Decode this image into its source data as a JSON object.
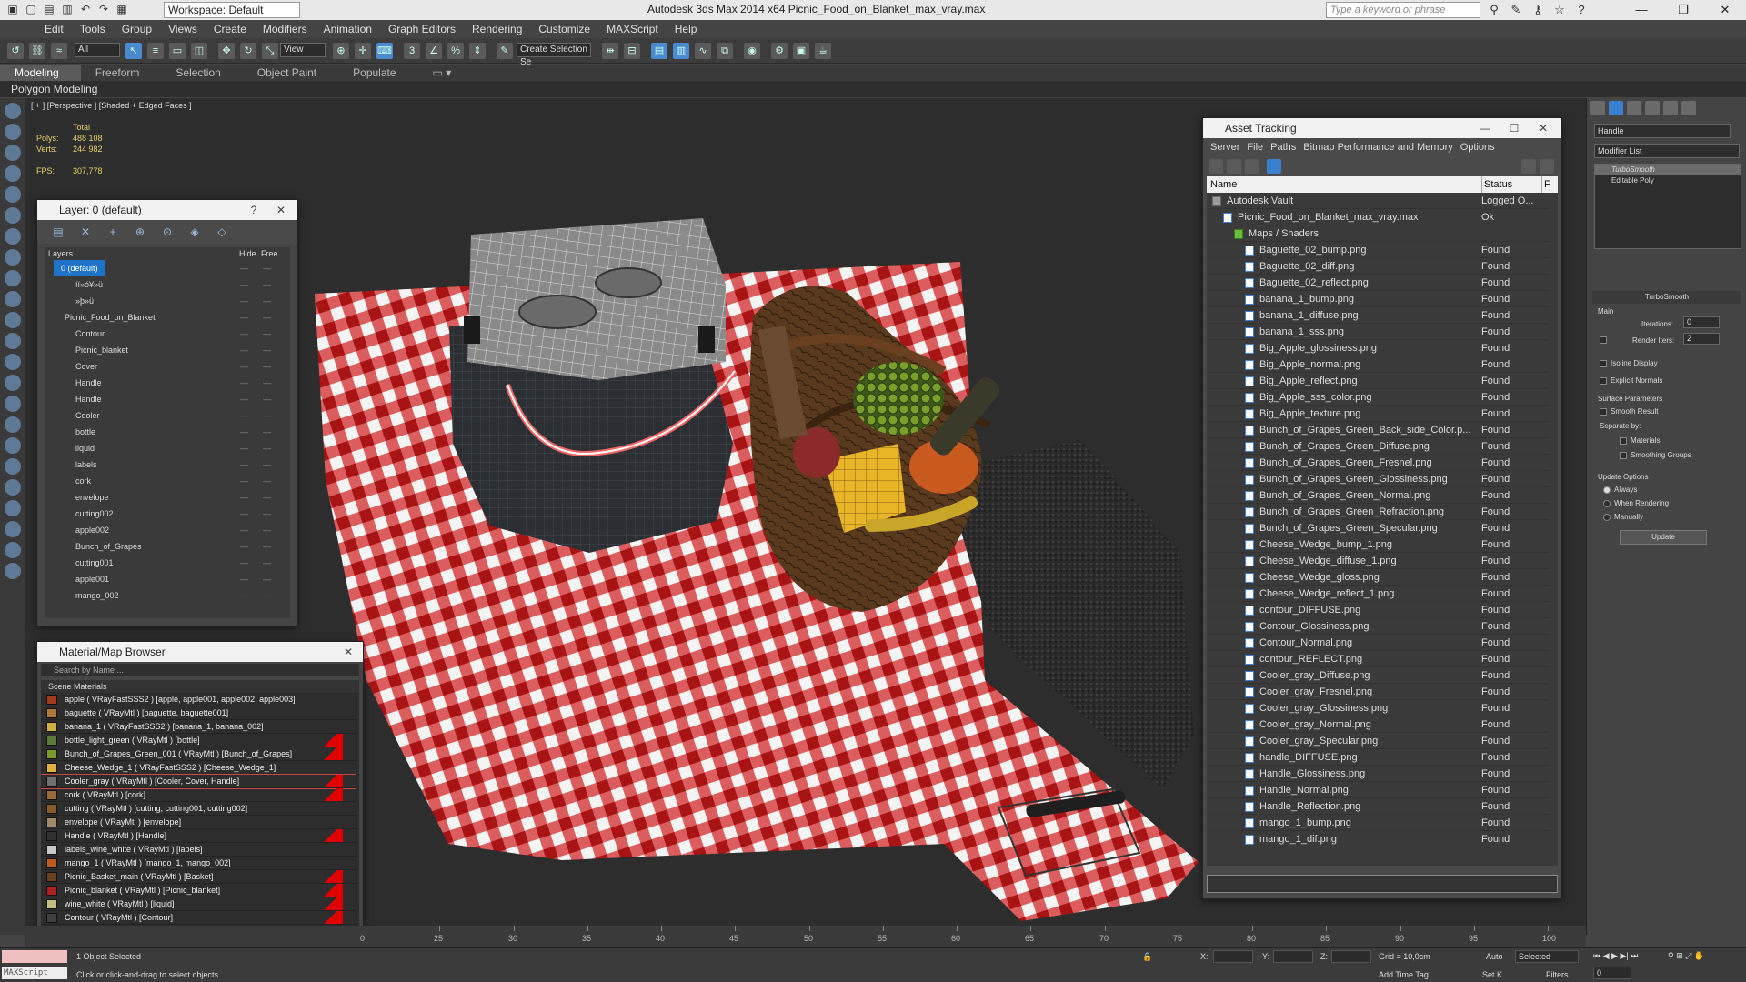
{
  "titlebar": {
    "workspace": "Workspace: Default",
    "app_title": "Autodesk 3ds Max  2014 x64     Picnic_Food_on_Blanket_max_vray.max",
    "search_placeholder": "Type a keyword or phrase"
  },
  "menu": [
    "Edit",
    "Tools",
    "Group",
    "Views",
    "Create",
    "Modifiers",
    "Animation",
    "Graph Editors",
    "Rendering",
    "Customize",
    "MAXScript",
    "Help"
  ],
  "toolbar": {
    "filter": "All",
    "ref_coord": "View",
    "selection_set": "Create Selection Se"
  },
  "ribbon": {
    "tabs": [
      "Modeling",
      "Freeform",
      "Selection",
      "Object Paint",
      "Populate"
    ],
    "active": "Modeling",
    "sub_label": "Polygon Modeling"
  },
  "viewport": {
    "label": "[ + ] [Perspective ] [Shaded + Edged Faces ]",
    "stats": {
      "header": "Total",
      "polys_label": "Polys:",
      "polys": "488 108",
      "verts_label": "Verts:",
      "verts": "244 982",
      "fps_label": "FPS:",
      "fps": "307,778"
    }
  },
  "layer_panel": {
    "title": "Layer: 0 (default)",
    "col_layers": "Layers",
    "col_hide": "Hide",
    "col_freeze": "Free",
    "rows": [
      {
        "name": "0 (default)",
        "indent": 0,
        "selected": true
      },
      {
        "name": "íí»ó¥»ü",
        "indent": 2
      },
      {
        "name": "»þ»ü",
        "indent": 2
      },
      {
        "name": "Picnic_Food_on_Blanket",
        "indent": 1
      },
      {
        "name": "Contour",
        "indent": 2
      },
      {
        "name": "Picnic_blanket",
        "indent": 2
      },
      {
        "name": "Cover",
        "indent": 2
      },
      {
        "name": "Handle",
        "indent": 2
      },
      {
        "name": "Handle",
        "indent": 2
      },
      {
        "name": "Cooler",
        "indent": 2
      },
      {
        "name": "bottle",
        "indent": 2
      },
      {
        "name": "liquid",
        "indent": 2
      },
      {
        "name": "labels",
        "indent": 2
      },
      {
        "name": "cork",
        "indent": 2
      },
      {
        "name": "envelope",
        "indent": 2
      },
      {
        "name": "cutting002",
        "indent": 2
      },
      {
        "name": "apple002",
        "indent": 2
      },
      {
        "name": "Bunch_of_Grapes",
        "indent": 2
      },
      {
        "name": "cutting001",
        "indent": 2
      },
      {
        "name": "apple001",
        "indent": 2
      },
      {
        "name": "mango_002",
        "indent": 2
      }
    ]
  },
  "material_browser": {
    "title": "Material/Map Browser",
    "search_placeholder": "Search by Name ...",
    "group": "Scene Materials",
    "rows": [
      {
        "label": "apple ( VRayFastSSS2 ) [apple, apple001, apple002, apple003]",
        "color": "#a33a1e",
        "flag": false
      },
      {
        "label": "baguette ( VRayMtl ) [baguette, baguette001]",
        "color": "#b0783a",
        "flag": false
      },
      {
        "label": "banana_1 ( VRayFastSSS2 ) [banana_1, banana_002]",
        "color": "#d1b040",
        "flag": false
      },
      {
        "label": "bottle_light_green ( VRayMtl ) [bottle]",
        "color": "#5a7a3a",
        "flag": true
      },
      {
        "label": "Bunch_of_Grapes_Green_001 ( VRayMtl ) [Bunch_of_Grapes]",
        "color": "#7a9a2a",
        "flag": true
      },
      {
        "label": "Cheese_Wedge_1 ( VRayFastSSS2 ) [Cheese_Wedge_1]",
        "color": "#e0b040",
        "flag": false
      },
      {
        "label": "Cooler_gray ( VRayMtl ) [Cooler, Cover, Handle]",
        "color": "#707070",
        "flag": true,
        "selected": true
      },
      {
        "label": "cork ( VRayMtl ) [cork]",
        "color": "#9a6a3a",
        "flag": true
      },
      {
        "label": "cutting ( VRayMtl ) [cutting, cutting001, cutting002]",
        "color": "#8a5a2a",
        "flag": false
      },
      {
        "label": "envelope ( VRayMtl ) [envelope]",
        "color": "#a08a6a",
        "flag": false
      },
      {
        "label": "Handle ( VRayMtl ) [Handle]",
        "color": "#303030",
        "flag": true
      },
      {
        "label": "labels_wine_white ( VRayMtl ) [labels]",
        "color": "#c8c8c8",
        "flag": false
      },
      {
        "label": "mango_1 ( VRayMtl ) [mango_1, mango_002]",
        "color": "#c05a20",
        "flag": false
      },
      {
        "label": "Picnic_Basket_main ( VRayMtl ) [Basket]",
        "color": "#6a4020",
        "flag": true
      },
      {
        "label": "Picnic_blanket ( VRayMtl ) [Picnic_blanket]",
        "color": "#b02020",
        "flag": true
      },
      {
        "label": "wine_white ( VRayMtl ) [liquid]",
        "color": "#c0c080",
        "flag": true
      },
      {
        "label": "Contour ( VRayMtl ) [Contour]",
        "color": "#404040",
        "flag": true
      }
    ]
  },
  "asset_tracking": {
    "title": "Asset Tracking",
    "menu": [
      "Server",
      "File",
      "Paths",
      "Bitmap Performance and Memory",
      "Options"
    ],
    "col_name": "Name",
    "col_status": "Status",
    "col_extra": "F",
    "rows": [
      {
        "name": "Autodesk Vault",
        "status": "Logged O...",
        "level": 0,
        "kind": "vault"
      },
      {
        "name": "Picnic_Food_on_Blanket_max_vray.max",
        "status": "Ok",
        "level": 1,
        "kind": "max"
      },
      {
        "name": "Maps / Shaders",
        "status": "",
        "level": 2,
        "kind": "folder"
      },
      {
        "name": "Baguette_02_bump.png",
        "status": "Found",
        "level": 3,
        "kind": "file"
      },
      {
        "name": "Baguette_02_diff.png",
        "status": "Found",
        "level": 3,
        "kind": "file"
      },
      {
        "name": "Baguette_02_reflect.png",
        "status": "Found",
        "level": 3,
        "kind": "file"
      },
      {
        "name": "banana_1_bump.png",
        "status": "Found",
        "level": 3,
        "kind": "file"
      },
      {
        "name": "banana_1_diffuse.png",
        "status": "Found",
        "level": 3,
        "kind": "file"
      },
      {
        "name": "banana_1_sss.png",
        "status": "Found",
        "level": 3,
        "kind": "file"
      },
      {
        "name": "Big_Apple_glossiness.png",
        "status": "Found",
        "level": 3,
        "kind": "file"
      },
      {
        "name": "Big_Apple_normal.png",
        "status": "Found",
        "level": 3,
        "kind": "file"
      },
      {
        "name": "Big_Apple_reflect.png",
        "status": "Found",
        "level": 3,
        "kind": "file"
      },
      {
        "name": "Big_Apple_sss_color.png",
        "status": "Found",
        "level": 3,
        "kind": "file"
      },
      {
        "name": "Big_Apple_texture.png",
        "status": "Found",
        "level": 3,
        "kind": "file"
      },
      {
        "name": "Bunch_of_Grapes_Green_Back_side_Color.p...",
        "status": "Found",
        "level": 3,
        "kind": "file"
      },
      {
        "name": "Bunch_of_Grapes_Green_Diffuse.png",
        "status": "Found",
        "level": 3,
        "kind": "file"
      },
      {
        "name": "Bunch_of_Grapes_Green_Fresnel.png",
        "status": "Found",
        "level": 3,
        "kind": "file"
      },
      {
        "name": "Bunch_of_Grapes_Green_Glossiness.png",
        "status": "Found",
        "level": 3,
        "kind": "file"
      },
      {
        "name": "Bunch_of_Grapes_Green_Normal.png",
        "status": "Found",
        "level": 3,
        "kind": "file"
      },
      {
        "name": "Bunch_of_Grapes_Green_Refraction.png",
        "status": "Found",
        "level": 3,
        "kind": "file"
      },
      {
        "name": "Bunch_of_Grapes_Green_Specular.png",
        "status": "Found",
        "level": 3,
        "kind": "file"
      },
      {
        "name": "Cheese_Wedge_bump_1.png",
        "status": "Found",
        "level": 3,
        "kind": "file"
      },
      {
        "name": "Cheese_Wedge_diffuse_1.png",
        "status": "Found",
        "level": 3,
        "kind": "file"
      },
      {
        "name": "Cheese_Wedge_gloss.png",
        "status": "Found",
        "level": 3,
        "kind": "file"
      },
      {
        "name": "Cheese_Wedge_reflect_1.png",
        "status": "Found",
        "level": 3,
        "kind": "file"
      },
      {
        "name": "contour_DIFFUSE.png",
        "status": "Found",
        "level": 3,
        "kind": "file"
      },
      {
        "name": "Contour_Glossiness.png",
        "status": "Found",
        "level": 3,
        "kind": "file"
      },
      {
        "name": "Contour_Normal.png",
        "status": "Found",
        "level": 3,
        "kind": "file"
      },
      {
        "name": "contour_REFLECT.png",
        "status": "Found",
        "level": 3,
        "kind": "file"
      },
      {
        "name": "Cooler_gray_Diffuse.png",
        "status": "Found",
        "level": 3,
        "kind": "file"
      },
      {
        "name": "Cooler_gray_Fresnel.png",
        "status": "Found",
        "level": 3,
        "kind": "file"
      },
      {
        "name": "Cooler_gray_Glossiness.png",
        "status": "Found",
        "level": 3,
        "kind": "file"
      },
      {
        "name": "Cooler_gray_Normal.png",
        "status": "Found",
        "level": 3,
        "kind": "file"
      },
      {
        "name": "Cooler_gray_Specular.png",
        "status": "Found",
        "level": 3,
        "kind": "file"
      },
      {
        "name": "handle_DIFFUSE.png",
        "status": "Found",
        "level": 3,
        "kind": "file"
      },
      {
        "name": "Handle_Glossiness.png",
        "status": "Found",
        "level": 3,
        "kind": "file"
      },
      {
        "name": "Handle_Normal.png",
        "status": "Found",
        "level": 3,
        "kind": "file"
      },
      {
        "name": "Handle_Reflection.png",
        "status": "Found",
        "level": 3,
        "kind": "file"
      },
      {
        "name": "mango_1_bump.png",
        "status": "Found",
        "level": 3,
        "kind": "file"
      },
      {
        "name": "mango_1_dif.png",
        "status": "Found",
        "level": 3,
        "kind": "file"
      }
    ]
  },
  "command_panel": {
    "object_name": "Handle",
    "modifier_list": "Modifier List",
    "stack": [
      "TurboSmooth",
      "Editable Poly"
    ],
    "rollout_title": "TurboSmooth",
    "main_label": "Main",
    "iterations_label": "Iterations:",
    "iterations": "0",
    "render_iters_label": "Render Iters:",
    "render_iters": "2",
    "isoline": "Isoline Display",
    "explicit_normals": "Explicit Normals",
    "surface_params": "Surface Parameters",
    "smooth_result": "Smooth Result",
    "separate_by": "Separate by:",
    "materials": "Materials",
    "smoothing_groups": "Smoothing Groups",
    "update_options": "Update Options",
    "always": "Always",
    "when_rendering": "When Rendering",
    "manually": "Manually",
    "update_button": "Update"
  },
  "timeline": {
    "ticks": [
      "0",
      "25",
      "30",
      "35",
      "40",
      "45",
      "50",
      "55",
      "60",
      "65",
      "70",
      "75",
      "80",
      "85",
      "90",
      "95",
      "100"
    ]
  },
  "statusbar": {
    "maxscript": "MAXScript",
    "message": "1 Object Selected",
    "hint": "Click or click-and-drag to select objects",
    "x_label": "X:",
    "y_label": "Y:",
    "z_label": "Z:",
    "grid": "Grid = 10,0cm",
    "add_time_tag": "Add Time Tag",
    "auto": "Auto",
    "set_key": "Set K.",
    "selected": "Selected",
    "filters": "Filters...",
    "frame": "0"
  }
}
